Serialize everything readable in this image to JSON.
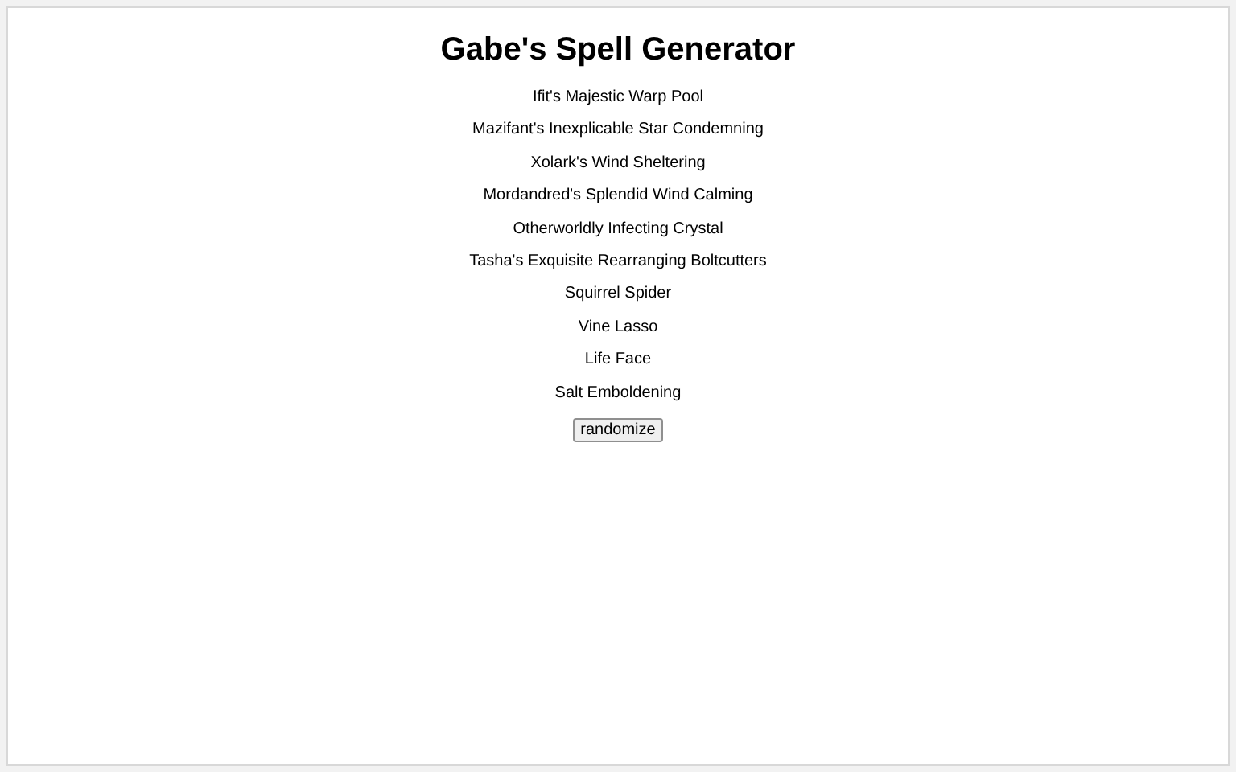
{
  "title": "Gabe's Spell Generator",
  "spells": [
    "Ifit's Majestic Warp Pool",
    "Mazifant's Inexplicable Star Condemning",
    "Xolark's Wind Sheltering",
    "Mordandred's Splendid Wind Calming",
    "Otherworldly Infecting Crystal",
    "Tasha's Exquisite Rearranging Boltcutters",
    "Squirrel Spider",
    "Vine Lasso",
    "Life Face",
    "Salt Emboldening"
  ],
  "button": "randomize"
}
